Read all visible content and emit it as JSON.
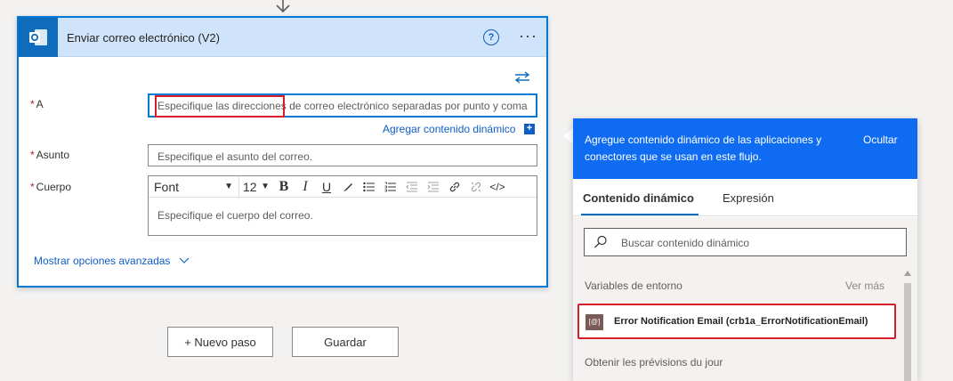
{
  "action": {
    "title": "Enviar correo electrónico (V2)",
    "help_label": "?",
    "more_label": "···"
  },
  "form": {
    "to_label": "A",
    "to_placeholder": "Especifique las direcciones de correo electrónico separadas por punto y coma",
    "add_dynamic_link": "Agregar contenido dinámico",
    "add_dynamic_plus": "+",
    "subject_label": "Asunto",
    "subject_placeholder": "Especifique el asunto del correo.",
    "body_label": "Cuerpo",
    "body_placeholder": "Especifique el cuerpo del correo.",
    "required_mark": "*",
    "font_value": "Font",
    "size_value": "12",
    "bold": "B",
    "italic": "I",
    "underline": "U",
    "code_view": "</>",
    "advanced_link": "Mostrar opciones avanzadas"
  },
  "buttons": {
    "new_step": "+ Nuevo paso",
    "save": "Guardar"
  },
  "panel": {
    "header_text": "Agregue contenido dinámico de las aplicaciones y conectores que se usan en este flujo.",
    "hide": "Ocultar",
    "tabs": [
      "Contenido dinámico",
      "Expresión"
    ],
    "search_placeholder": "Buscar contenido dinámico",
    "section_env": "Variables de entorno",
    "see_more": "Ver más",
    "item_icon": "[@]",
    "item_label": "Error Notification Email (crb1a_ErrorNotificationEmail)",
    "section_next": "Obtenir les prévisions du jour"
  },
  "colors": {
    "accent": "#0f6cbd",
    "panel_header": "#0f6cf2",
    "highlight": "#d81e2a"
  }
}
